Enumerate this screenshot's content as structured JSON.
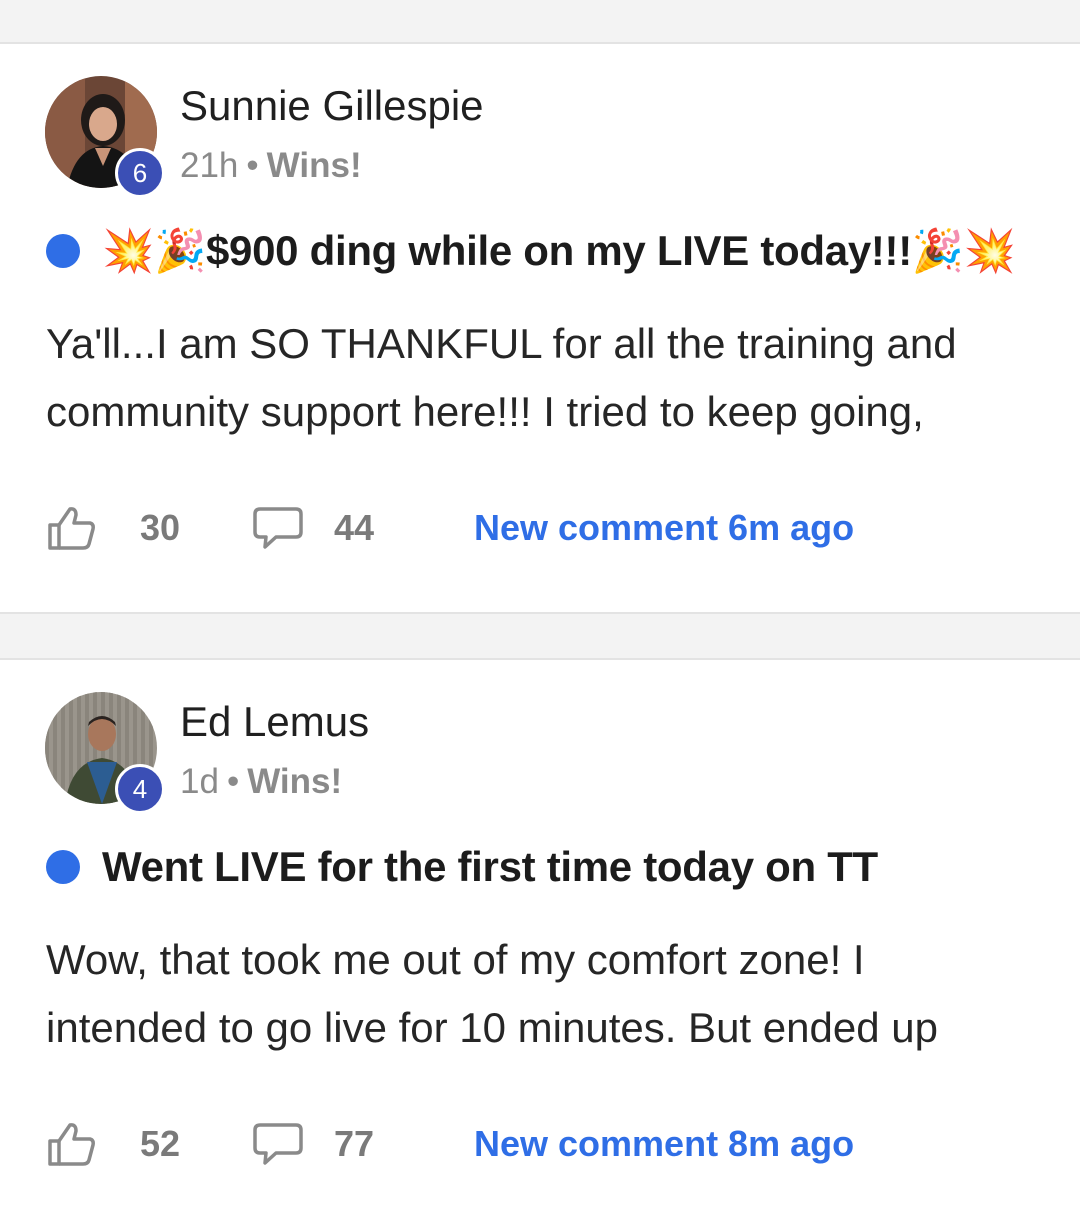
{
  "posts": [
    {
      "author": "Sunnie Gillespie",
      "level": "6",
      "time": "21h",
      "separator": "•",
      "category": "Wins!",
      "title": "💥🎉$900 ding while on my LIVE today!!!🎉💥",
      "body": "Ya'll...I am SO THANKFUL for all the training and community support here!!! I tried to keep going,",
      "likes": "30",
      "comments": "44",
      "new_comment": "New comment 6m ago",
      "avatar": "woman-portrait"
    },
    {
      "author": "Ed Lemus",
      "level": "4",
      "time": "1d",
      "separator": "•",
      "category": "Wins!",
      "title": "Went LIVE for the first time today on TT",
      "body": "Wow, that took me out of my comfort zone! I intended to go live for 10 minutes. But ended up",
      "likes": "52",
      "comments": "77",
      "new_comment": "New comment 8m ago",
      "avatar": "man-portrait"
    }
  ],
  "colors": {
    "accent": "#2f6ee6",
    "badge": "#3b4fb5",
    "meta": "#8a8a8a",
    "background": "#f3f3f3"
  },
  "icons": {
    "like": "thumbs-up-icon",
    "comment": "speech-bubble-icon",
    "unread": "unread-dot-icon"
  }
}
